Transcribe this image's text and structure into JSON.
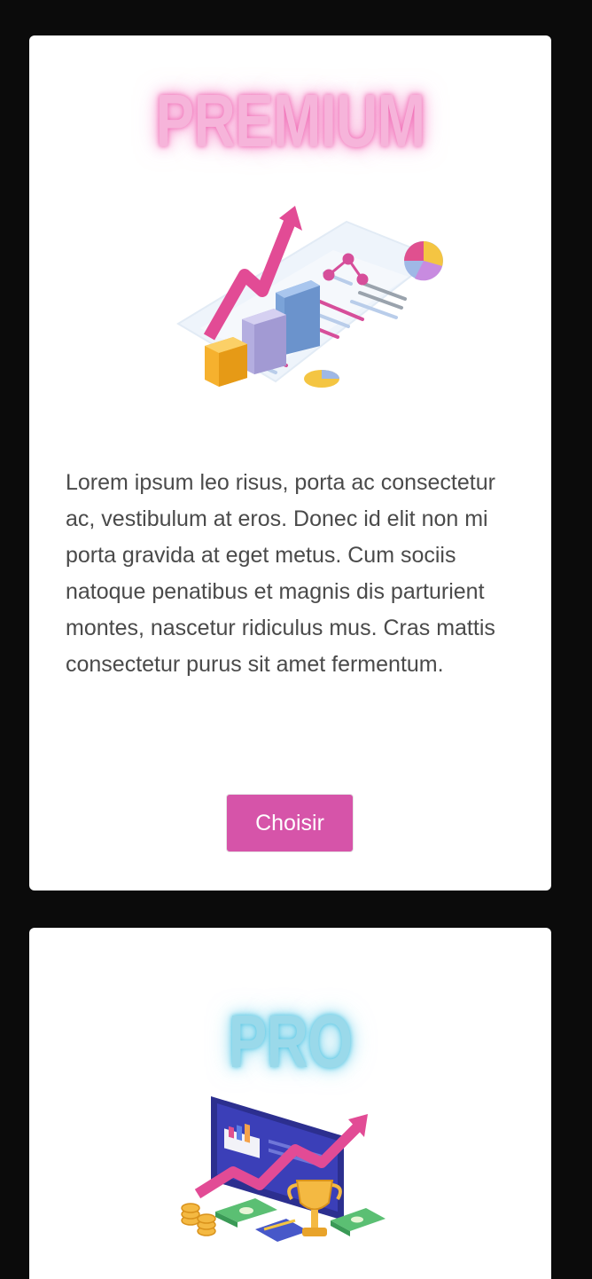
{
  "plans": [
    {
      "title": "PREMIUM",
      "illustration": "growth-chart-report-illustration",
      "description": "Lorem ipsum leo risus, porta ac consectetur ac, vestibulum at eros. Donec id elit non mi porta gravida at eget metus. Cum sociis natoque penatibus et magnis dis parturient montes, nascetur ridiculus mus. Cras mattis consectetur purus sit amet fermentum.",
      "button_label": "Choisir",
      "accent": "#d654a9",
      "glow": "#f48bc8"
    },
    {
      "title": "PRO",
      "illustration": "monitor-money-trophy-illustration",
      "accent": "#4fc4e3",
      "glow": "#79d2ea"
    }
  ],
  "colors": {
    "background": "#0b0b0b",
    "card": "#ffffff",
    "text": "#4a4a4a"
  }
}
